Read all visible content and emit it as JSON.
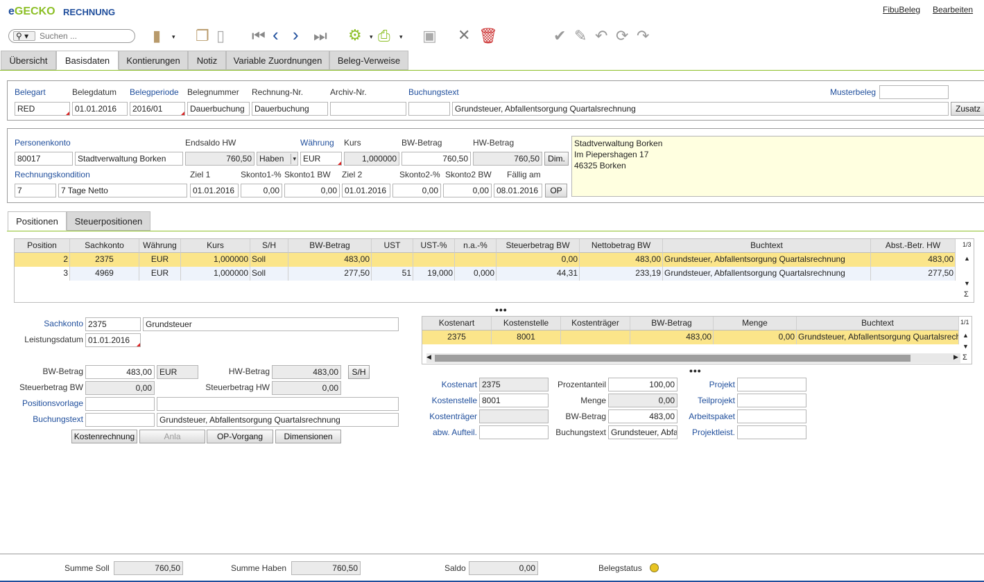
{
  "app": {
    "logo_e": "e",
    "logo_rest": "GECKO",
    "title": "RECHNUNG",
    "menu_fibu": "FibuBeleg",
    "menu_edit": "Bearbeiten"
  },
  "search": {
    "placeholder": "Suchen ..."
  },
  "tabs": [
    "Übersicht",
    "Basisdaten",
    "Kontierungen",
    "Notiz",
    "Variable Zuordnungen",
    "Beleg-Verweise"
  ],
  "head": {
    "belegart_label": "Belegart",
    "belegart": "RED",
    "belegdatum_label": "Belegdatum",
    "belegdatum": "01.01.2016",
    "belegperiode_label": "Belegperiode",
    "belegperiode": "2016/01",
    "belegnummer_label": "Belegnummer",
    "belegnummer": "Dauerbuchung",
    "rechnungnr_label": "Rechnung-Nr.",
    "rechnungnr": "Dauerbuchung",
    "archivnr_label": "Archiv-Nr.",
    "archivnr": "",
    "buchungstext_label": "Buchungstext",
    "buchungstext": "Grundsteuer, Abfallentsorgung Quartalsrechnung",
    "musterbeleg_label": "Musterbeleg",
    "zusatz": "Zusatz"
  },
  "person": {
    "konto_label": "Personenkonto",
    "konto": "80017",
    "name": "Stadtverwaltung Borken",
    "endsaldo_label": "Endsaldo HW",
    "endsaldo": "760,50",
    "haben": "Haben",
    "waehrung_label": "Währung",
    "waehrung": "EUR",
    "kurs_label": "Kurs",
    "kurs": "1,000000",
    "bw_label": "BW-Betrag",
    "bw": "760,50",
    "hw_label": "HW-Betrag",
    "hw": "760,50",
    "dim": "Dim.",
    "kond_label": "Rechnungskondition",
    "kond": "7",
    "kond_text": "7 Tage Netto",
    "ziel1_label": "Ziel 1",
    "ziel1": "01.01.2016",
    "sk1p_label": "Skonto1-%",
    "sk1p": "0,00",
    "sk1bw_label": "Skonto1 BW",
    "sk1bw": "0,00",
    "ziel2_label": "Ziel 2",
    "ziel2": "01.01.2016",
    "sk2p_label": "Skonto2-%",
    "sk2p": "0,00",
    "sk2bw_label": "Skonto2 BW",
    "sk2bw": "0,00",
    "faellig_label": "Fällig am",
    "faellig": "08.01.2016",
    "op": "OP",
    "address": [
      "Stadtverwaltung Borken",
      "Im Piepershagen 17",
      "46325 Borken"
    ]
  },
  "subtabs": [
    "Positionen",
    "Steuerpositionen"
  ],
  "positions": {
    "headers": [
      "Position",
      "Sachkonto",
      "Währung",
      "Kurs",
      "S/H",
      "BW-Betrag",
      "UST",
      "UST-%",
      "n.a.-%",
      "Steuerbetrag BW",
      "Nettobetrag BW",
      "Buchtext",
      "Abst.-Betr. HW"
    ],
    "rows": [
      [
        "2",
        "2375",
        "EUR",
        "1,000000",
        "Soll",
        "483,00",
        "",
        "",
        "",
        "0,00",
        "483,00",
        "Grundsteuer, Abfallentsorgung Quartalsrechnung",
        "483,00"
      ],
      [
        "3",
        "4969",
        "EUR",
        "1,000000",
        "Soll",
        "277,50",
        "51",
        "19,000",
        "0,000",
        "44,31",
        "233,19",
        "Grundsteuer, Abfallentsorgung Quartalsrechnung",
        "277,50"
      ]
    ],
    "pager": "1/3",
    "sigma": "Σ"
  },
  "detail": {
    "sachkonto_label": "Sachkonto",
    "sachkonto": "2375",
    "sachkonto_text": "Grundsteuer",
    "leistung_label": "Leistungsdatum",
    "leistung": "01.01.2016",
    "bw_label": "BW-Betrag",
    "bw": "483,00",
    "bw_cur": "EUR",
    "hw_label": "HW-Betrag",
    "hw": "483,00",
    "sh": "S/H",
    "stbw_label": "Steuerbetrag BW",
    "stbw": "0,00",
    "sthw_label": "Steuerbetrag HW",
    "sthw": "0,00",
    "posvorlage_label": "Positionsvorlage",
    "buchungstext_label": "Buchungstext",
    "buchungstext": "Grundsteuer, Abfallentsorgung Quartalsrechnung",
    "btn_kosten": "Kostenrechnung",
    "btn_anla": "Anla",
    "btn_op": "OP-Vorgang",
    "btn_dim": "Dimensionen"
  },
  "kosten": {
    "headers": [
      "Kostenart",
      "Kostenstelle",
      "Kostenträger",
      "BW-Betrag",
      "Menge",
      "Buchtext"
    ],
    "rows": [
      [
        "2375",
        "8001",
        "",
        "483,00",
        "0,00",
        "Grundsteuer, Abfallentsorgung Quartalsrech"
      ]
    ],
    "pager": "1/1",
    "sigma": "Σ",
    "kostenart_label": "Kostenart",
    "kostenart": "2375",
    "kostenstelle_label": "Kostenstelle",
    "kostenstelle": "8001",
    "kostentraeger_label": "Kostenträger",
    "aufteil_label": "abw. Aufteil.",
    "prozent_label": "Prozentanteil",
    "prozent": "100,00",
    "menge_label": "Menge",
    "menge": "0,00",
    "bw_label": "BW-Betrag",
    "bw": "483,00",
    "btext_label": "Buchungstext",
    "btext": "Grundsteuer, Abfallentsorgung",
    "projekt_label": "Projekt",
    "teilprojekt_label": "Teilprojekt",
    "arbeitspaket_label": "Arbeitspaket",
    "projektleist_label": "Projektleist."
  },
  "footer": {
    "soll_label": "Summe Soll",
    "soll": "760,50",
    "haben_label": "Summe Haben",
    "haben": "760,50",
    "saldo_label": "Saldo",
    "saldo": "0,00",
    "status_label": "Belegstatus"
  },
  "colors": {
    "accent_green": "#8cbf26",
    "link_blue": "#1f4e9c",
    "row_highlight": "#fbe58a",
    "status_yellow": "#e8c422"
  }
}
